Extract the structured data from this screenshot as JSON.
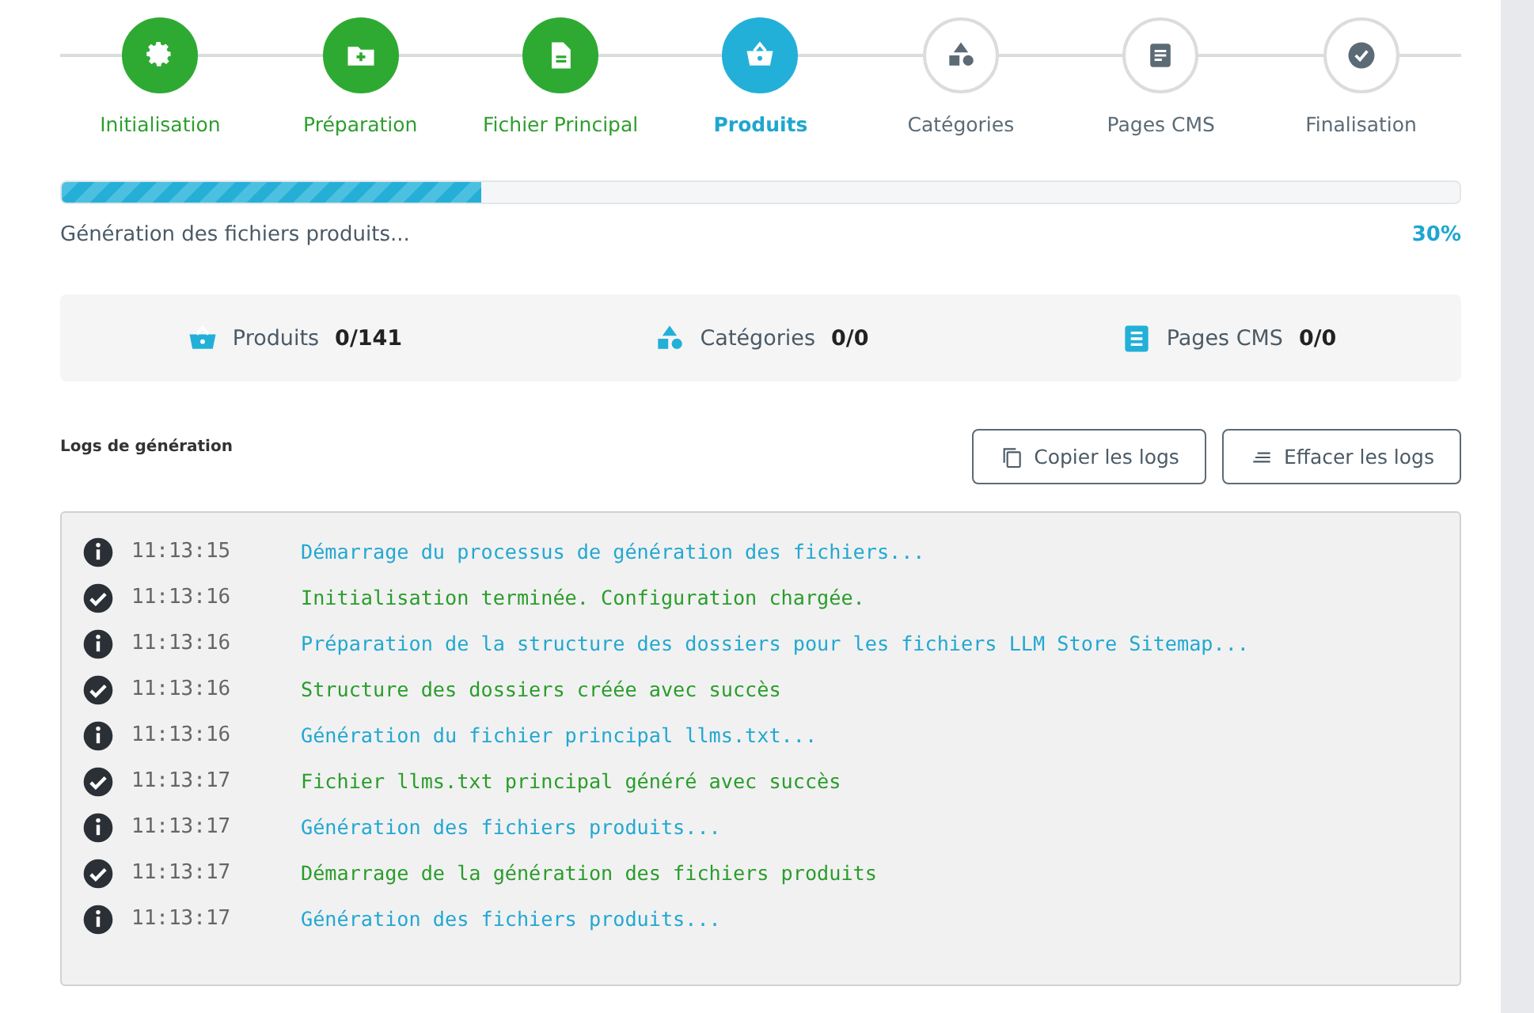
{
  "steps": [
    {
      "label": "Initialisation",
      "completed": true,
      "selected": false
    },
    {
      "label": "Préparation",
      "completed": true,
      "selected": false
    },
    {
      "label": "Fichier Principal",
      "completed": true,
      "selected": false
    },
    {
      "label": "Produits",
      "completed": false,
      "selected": true
    },
    {
      "label": "Catégories",
      "completed": false,
      "selected": false
    },
    {
      "label": "Pages CMS",
      "completed": false,
      "selected": false
    },
    {
      "label": "Finalisation",
      "completed": false,
      "selected": false
    }
  ],
  "progress": {
    "level": 0.3,
    "message": "Génération des fichiers produits...",
    "percent": "30%"
  },
  "stats": [
    {
      "label": "Produits",
      "value": "0/141"
    },
    {
      "label": "Catégories",
      "value": "0/0"
    },
    {
      "label": "Pages CMS",
      "value": "0/0"
    }
  ],
  "logs": {
    "title": "Logs de génération",
    "buttons": [
      "Copier les logs",
      "Effacer les logs"
    ],
    "entries": [
      {
        "kind": "info",
        "time": "11:13:15",
        "message": "Démarrage du processus de génération des fichiers..."
      },
      {
        "kind": "success",
        "time": "11:13:16",
        "message": "Initialisation terminée. Configuration chargée."
      },
      {
        "kind": "info",
        "time": "11:13:16",
        "message": "Préparation de la structure des dossiers pour les fichiers LLM Store Sitemap..."
      },
      {
        "kind": "success",
        "time": "11:13:16",
        "message": "Structure des dossiers créée avec succès"
      },
      {
        "kind": "info",
        "time": "11:13:16",
        "message": "Génération du fichier principal llms.txt..."
      },
      {
        "kind": "success",
        "time": "11:13:17",
        "message": "Fichier llms.txt principal généré avec succès"
      },
      {
        "kind": "info",
        "time": "11:13:17",
        "message": "Génération des fichiers produits..."
      },
      {
        "kind": "success",
        "time": "11:13:17",
        "message": "Démarrage de la génération des fichiers produits"
      },
      {
        "kind": "info",
        "time": "11:13:17",
        "message": "Génération des fichiers produits..."
      }
    ]
  }
}
